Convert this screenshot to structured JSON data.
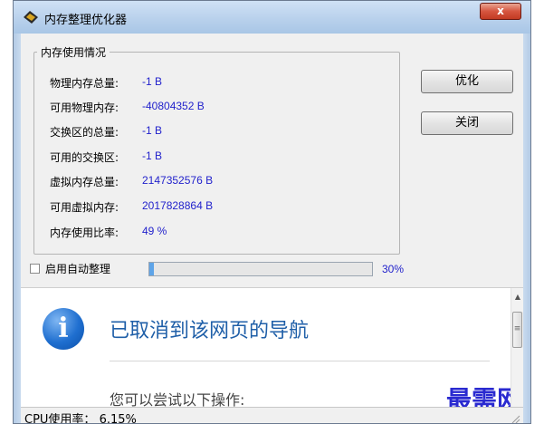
{
  "window": {
    "title": "内存整理优化器",
    "close_symbol": "x",
    "app_icon": "memory-chip-icon"
  },
  "memory_group": {
    "title": "内存使用情况",
    "rows": [
      {
        "label": "物理内存总量:",
        "value": "-1 B"
      },
      {
        "label": "可用物理内存:",
        "value": "-40804352 B"
      },
      {
        "label": "交换区的总量:",
        "value": "-1 B"
      },
      {
        "label": "可用的交换区:",
        "value": "-1 B"
      },
      {
        "label": "虚拟内存总量:",
        "value": "2147352576 B"
      },
      {
        "label": "可用虚拟内存:",
        "value": "2017828864 B"
      },
      {
        "label": "内存使用比率:",
        "value": "49 %"
      }
    ]
  },
  "buttons": {
    "optimize": "优化",
    "close": "关闭"
  },
  "auto": {
    "label": "启用自动整理",
    "checked": false
  },
  "progress": {
    "value": 0.02,
    "percent_text": "30%"
  },
  "browser": {
    "heading": "已取消到该网页的导航",
    "sub": "您可以尝试以下操作:",
    "icon": "info-icon"
  },
  "watermark": "最需网",
  "status": {
    "text": "CPU使用率： 6.15%"
  },
  "colors": {
    "value_text": "#2222cc",
    "heading": "#1f5fa8",
    "info_icon": "#1f6fd0"
  }
}
